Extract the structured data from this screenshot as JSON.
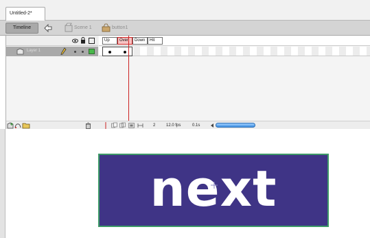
{
  "document": {
    "tab_title": "Untitled-2*"
  },
  "edit_bar": {
    "timeline_label": "Timeline",
    "scene_label": "Scene 1",
    "symbol_label": "button1"
  },
  "layers": [
    {
      "name": "Layer 1",
      "outline_color": "#49b84b"
    }
  ],
  "frame_labels": [
    "Up",
    "Over",
    "Down",
    "Hit"
  ],
  "timeline_status": {
    "current_frame": "2",
    "frame_rate": "12.0 fps",
    "elapsed_time": "0.1s"
  },
  "stage": {
    "button_text": "next",
    "button_fill": "#3f3486",
    "button_stroke": "#3d9a67"
  },
  "colors": {
    "playhead": "#cc2222",
    "scroll_thumb": "#3e8fe0"
  }
}
